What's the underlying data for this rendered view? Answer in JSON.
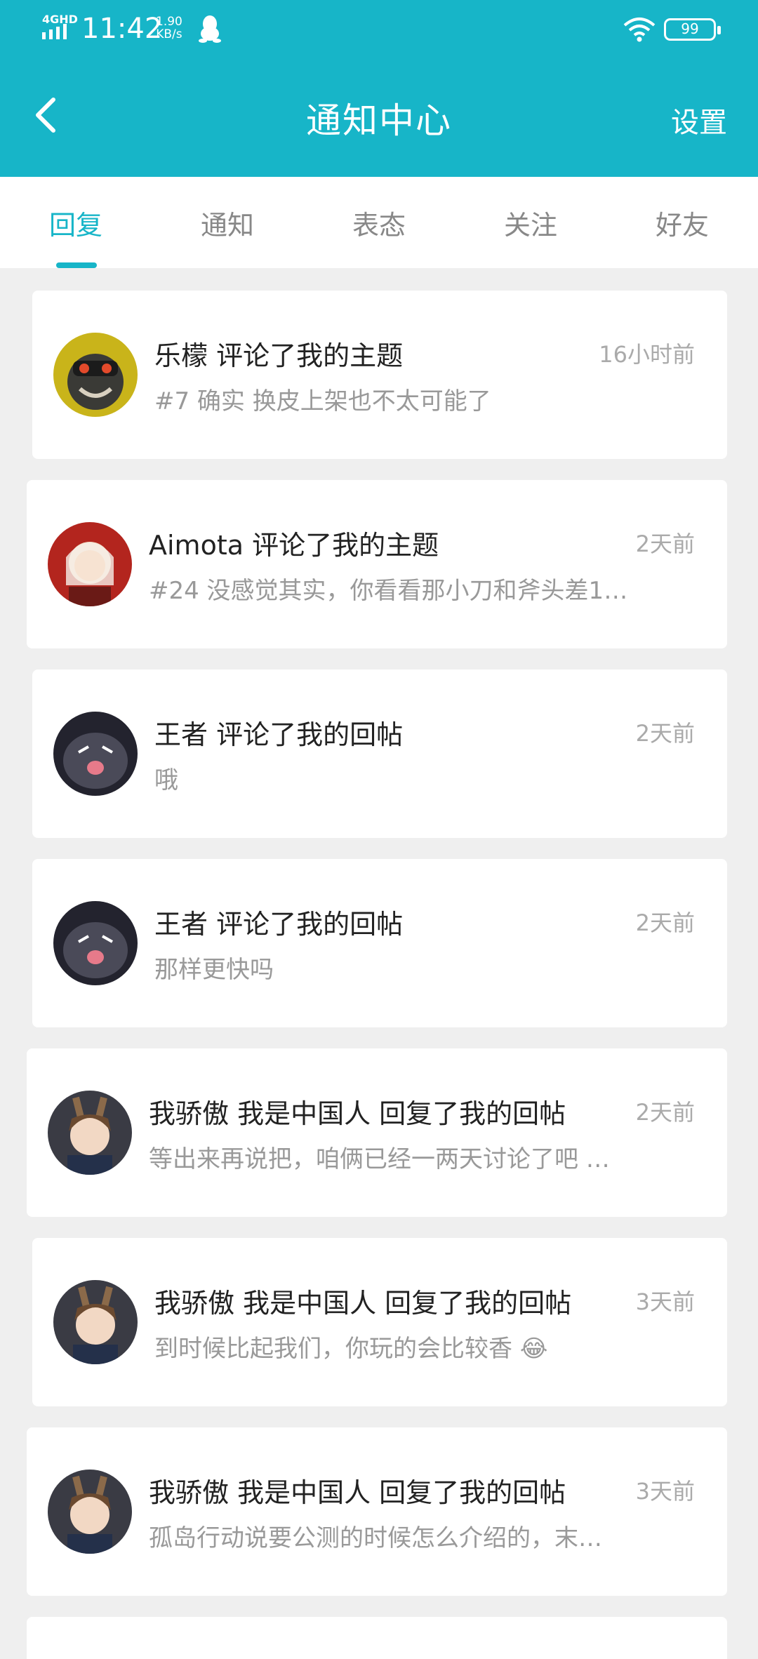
{
  "status": {
    "network": "4GHD",
    "time": "11:42",
    "speed_value": "1.90",
    "speed_unit": "KB/s",
    "battery": "99"
  },
  "nav": {
    "title": "通知中心",
    "settings": "设置"
  },
  "tabs": [
    "回复",
    "通知",
    "表态",
    "关注",
    "好友"
  ],
  "notifications": [
    {
      "title": "乐檬 评论了我的主题",
      "time": "16小时前",
      "text": "#7 确实 换皮上架也不太可能了"
    },
    {
      "title": "Aimota 评论了我的主题",
      "time": "2天前",
      "text": "#24 没感觉其实，你看看那小刀和斧头差1…"
    },
    {
      "title": "王者 评论了我的回帖",
      "time": "2天前",
      "text": "哦"
    },
    {
      "title": "王者 评论了我的回帖",
      "time": "2天前",
      "text": "那样更快吗"
    },
    {
      "title": "我骄傲 我是中国人 回复了我的回帖",
      "time": "2天前",
      "text": "等出来再说把，咱俩已经一两天讨论了吧 …"
    },
    {
      "title": "我骄傲 我是中国人 回复了我的回帖",
      "time": "3天前",
      "text": "到时候比起我们，你玩的会比较香 😂"
    },
    {
      "title": "我骄傲 我是中国人 回复了我的回帖",
      "time": "3天前",
      "text": "孤岛行动说要公测的时候怎么介绍的，末…"
    }
  ],
  "colors": {
    "accent": "#17b5c8",
    "background": "#efefef"
  }
}
